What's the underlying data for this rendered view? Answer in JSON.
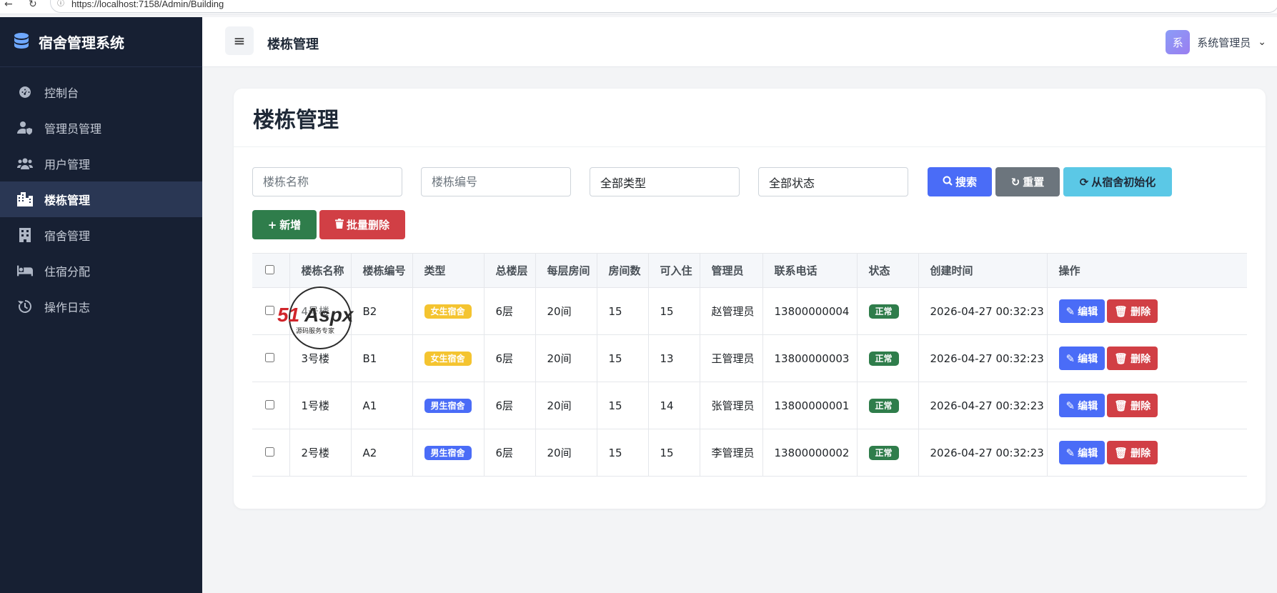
{
  "browser": {
    "url": "https://localhost:7158/Admin/Building"
  },
  "sidebar": {
    "brand": "宿舍管理系统",
    "items": [
      {
        "label": "控制台",
        "icon": "dashboard-icon"
      },
      {
        "label": "管理员管理",
        "icon": "user-shield-icon"
      },
      {
        "label": "用户管理",
        "icon": "users-icon"
      },
      {
        "label": "楼栋管理",
        "icon": "city-icon",
        "active": true
      },
      {
        "label": "宿舍管理",
        "icon": "building-icon"
      },
      {
        "label": "住宿分配",
        "icon": "bed-icon"
      },
      {
        "label": "操作日志",
        "icon": "history-icon"
      }
    ]
  },
  "header": {
    "title": "楼栋管理",
    "user_initial": "系",
    "user_name": "系统管理员"
  },
  "page": {
    "title": "楼栋管理",
    "filters": {
      "name_placeholder": "楼栋名称",
      "code_placeholder": "楼栋编号",
      "type_select": "全部类型",
      "status_select": "全部状态"
    },
    "buttons": {
      "search": "搜索",
      "reset": "重置",
      "init": "从宿舍初始化",
      "add": "新增",
      "batch_delete": "批量删除"
    },
    "table": {
      "headers": [
        "楼栋名称",
        "楼栋编号",
        "类型",
        "总楼层",
        "每层房间",
        "房间数",
        "可入住",
        "管理员",
        "联系电话",
        "状态",
        "创建时间",
        "操作"
      ],
      "rows": [
        {
          "name": "4号楼",
          "code": "B2",
          "type": "女生宿舍",
          "floors": "6层",
          "rooms_per_floor": "20间",
          "rooms": "15",
          "available": "15",
          "manager": "赵管理员",
          "phone": "13800000004",
          "status": "正常",
          "created": "2026-04-27 00:32:23"
        },
        {
          "name": "3号楼",
          "code": "B1",
          "type": "女生宿舍",
          "floors": "6层",
          "rooms_per_floor": "20间",
          "rooms": "15",
          "available": "13",
          "manager": "王管理员",
          "phone": "13800000003",
          "status": "正常",
          "created": "2026-04-27 00:32:23"
        },
        {
          "name": "1号楼",
          "code": "A1",
          "type": "男生宿舍",
          "floors": "6层",
          "rooms_per_floor": "20间",
          "rooms": "15",
          "available": "14",
          "manager": "张管理员",
          "phone": "13800000001",
          "status": "正常",
          "created": "2026-04-27 00:32:23"
        },
        {
          "name": "2号楼",
          "code": "A2",
          "type": "男生宿舍",
          "floors": "6层",
          "rooms_per_floor": "20间",
          "rooms": "15",
          "available": "15",
          "manager": "李管理员",
          "phone": "13800000002",
          "status": "正常",
          "created": "2026-04-27 00:32:23"
        }
      ],
      "edit_label": "编辑",
      "delete_label": "删除"
    },
    "watermark": {
      "brand": "51Aspx",
      "tagline": "源码服务专家"
    }
  },
  "colors": {
    "sidebar_bg": "#172033",
    "primary": "#4a6cf7",
    "danger": "#d13f45",
    "success": "#2f7d4b",
    "info": "#5bc8e6",
    "female_badge": "#f4c430"
  }
}
